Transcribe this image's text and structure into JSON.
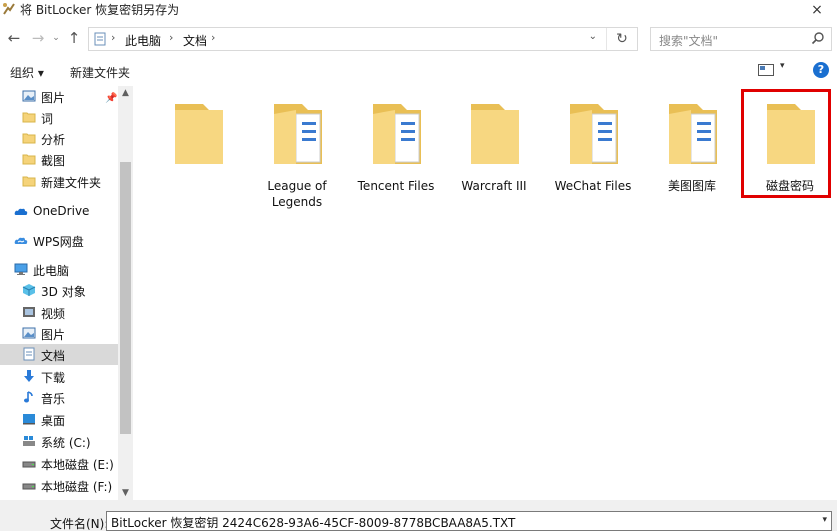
{
  "window": {
    "title": "将 BitLocker 恢复密钥另存为",
    "close_symbol": "×"
  },
  "nav": {
    "back": "←",
    "forward": "→",
    "up": "↑",
    "breadcrumb": [
      "此电脑",
      "文档"
    ],
    "sep": "›",
    "dropdown": "⌄",
    "refresh": "↻",
    "search_placeholder": "搜索\"文档\""
  },
  "toolbar": {
    "organize": "组织 ▾",
    "new_folder": "新建文件夹",
    "help": "?",
    "view_dd": "▾"
  },
  "sidebar": {
    "items": [
      {
        "label": "图片",
        "icon": "pictures-icon"
      },
      {
        "label": "词",
        "icon": "folder-icon"
      },
      {
        "label": "分析",
        "icon": "folder-icon"
      },
      {
        "label": "截图",
        "icon": "folder-icon"
      },
      {
        "label": "新建文件夹",
        "icon": "folder-icon"
      },
      {
        "label": "OneDrive",
        "icon": "onedrive-icon"
      },
      {
        "label": "WPS网盘",
        "icon": "wps-cloud-icon"
      },
      {
        "label": "此电脑",
        "icon": "this-pc-icon"
      },
      {
        "label": "3D 对象",
        "icon": "3d-objects-icon"
      },
      {
        "label": "视频",
        "icon": "videos-icon"
      },
      {
        "label": "图片",
        "icon": "pictures-icon"
      },
      {
        "label": "文档",
        "icon": "documents-icon"
      },
      {
        "label": "下载",
        "icon": "download-icon"
      },
      {
        "label": "音乐",
        "icon": "music-icon"
      },
      {
        "label": "桌面",
        "icon": "desktop-icon"
      },
      {
        "label": "系统 (C:)",
        "icon": "system-drive-icon"
      },
      {
        "label": "本地磁盘 (E:)",
        "icon": "drive-icon"
      },
      {
        "label": "本地磁盘 (F:)",
        "icon": "drive-icon"
      }
    ],
    "selected": "文档",
    "scroll_up": "▲",
    "scroll_down": "▼"
  },
  "folders": [
    {
      "label": ""
    },
    {
      "label": "League of Legends"
    },
    {
      "label": "Tencent Files"
    },
    {
      "label": "Warcraft III"
    },
    {
      "label": "WeChat Files"
    },
    {
      "label": "美图图库"
    },
    {
      "label": "磁盘密码"
    }
  ],
  "filename": {
    "label": "文件名(N):",
    "value": "BitLocker 恢复密钥 2424C628-93A6-45CF-8009-8778BCBAA8A5.TXT",
    "dropdown": "▾"
  },
  "colors": {
    "highlight": "#e00000",
    "folder": "#f5d37a",
    "selected_bg": "#d9d9d9"
  }
}
